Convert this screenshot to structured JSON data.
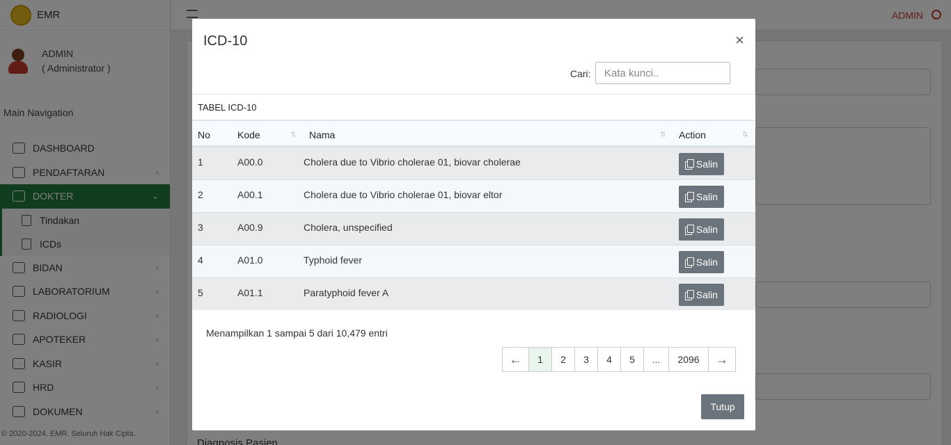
{
  "app": {
    "brand": "EMR",
    "user_name": "ADMIN",
    "user_role": "( Administrator )",
    "topbar_user": "ADMIN",
    "copyright": "© 2020-2024. EMR. Seluruh Hak Cipta."
  },
  "sidebar": {
    "section_title": "Main Navigation",
    "items": [
      {
        "label": "DASHBOARD",
        "icon": "dashboard-icon"
      },
      {
        "label": "PENDAFTARAN",
        "icon": "register-icon"
      },
      {
        "label": "DOKTER",
        "icon": "doctor-icon"
      },
      {
        "label": "BIDAN",
        "icon": "midwife-icon"
      },
      {
        "label": "LABORATORIUM",
        "icon": "lab-icon"
      },
      {
        "label": "RADIOLOGI",
        "icon": "radiology-icon"
      },
      {
        "label": "APOTEKER",
        "icon": "pharmacy-icon"
      },
      {
        "label": "KASIR",
        "icon": "cashier-icon"
      },
      {
        "label": "HRD",
        "icon": "hr-icon"
      },
      {
        "label": "DOKUMEN",
        "icon": "document-icon"
      }
    ],
    "sub_items": [
      {
        "label": "Tindakan"
      },
      {
        "label": "ICDs"
      }
    ]
  },
  "background": {
    "field_label": "Diagnosis Pasien"
  },
  "modal": {
    "title": "ICD-10",
    "search_label": "Cari:",
    "search_placeholder": "Kata kunci..",
    "table_title": "TABEL ICD-10",
    "columns": {
      "no": "No",
      "kode": "Kode",
      "nama": "Nama",
      "action": "Action"
    },
    "rows": [
      {
        "no": "1",
        "kode": "A00.0",
        "nama": "Cholera due to Vibrio cholerae 01, biovar cholerae",
        "action": "Salin"
      },
      {
        "no": "2",
        "kode": "A00.1",
        "nama": "Cholera due to Vibrio cholerae 01, biovar eltor",
        "action": "Salin"
      },
      {
        "no": "3",
        "kode": "A00.9",
        "nama": "Cholera, unspecified",
        "action": "Salin"
      },
      {
        "no": "4",
        "kode": "A01.0",
        "nama": "Typhoid fever",
        "action": "Salin"
      },
      {
        "no": "5",
        "kode": "A01.1",
        "nama": "Paratyphoid fever A",
        "action": "Salin"
      }
    ],
    "info": "Menampilkan 1 sampai 5 dari 10,479 entri",
    "pagination": {
      "prev": "←",
      "pages": [
        "1",
        "2",
        "3",
        "4",
        "5"
      ],
      "ellipsis": "...",
      "last": "2096",
      "next": "→",
      "current": "1"
    },
    "close_button": "Tutup",
    "close_icon": "×"
  },
  "colors": {
    "accent": "#1f7a3c",
    "button": "#6b747c",
    "alert": "#c0392b"
  }
}
